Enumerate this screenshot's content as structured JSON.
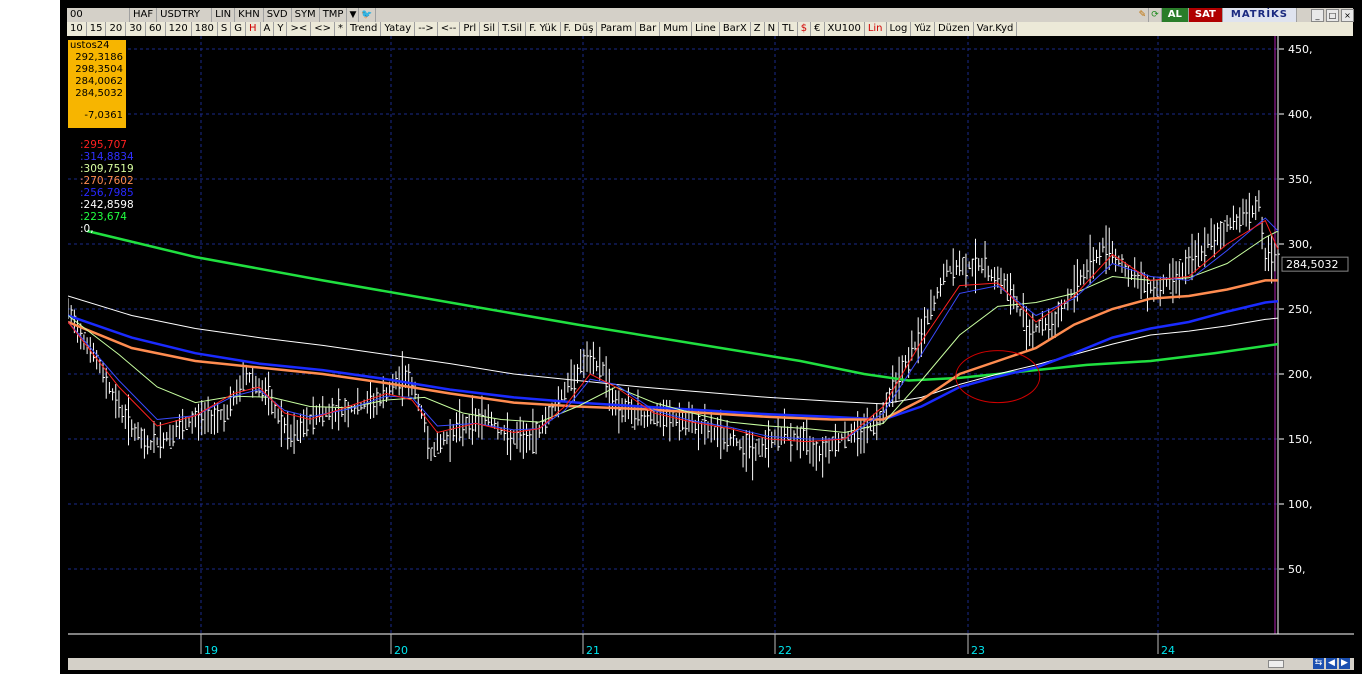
{
  "toolbar1": {
    "period_label": "00",
    "items": [
      "HAF",
      "USDTRY",
      "LIN",
      "KHN",
      "SVD",
      "SYM",
      "TMP"
    ],
    "buy": "AL",
    "sell": "SAT",
    "brand": "MATRİKS"
  },
  "toolbar2": {
    "items": [
      "10",
      "15",
      "20",
      "30",
      "60",
      "120",
      "180",
      "S",
      "G",
      "H",
      "A",
      "Y",
      ">< ",
      "<>",
      "*",
      "Trend",
      "Yatay",
      "-->",
      "<--",
      "Prl",
      "Sil",
      "T.Sil",
      "F. Yük",
      "F. Düş",
      "Param",
      "Bar",
      "Mum",
      "Line",
      "BarX",
      "Z",
      "N",
      "TL",
      "$",
      "€",
      "XU100",
      "Lin",
      "Log",
      "Yüz",
      "Düzen",
      "Var.Kyd"
    ],
    "active": [
      "H",
      "$",
      "Lin"
    ]
  },
  "ohlc": {
    "date": "ustos24",
    "open": "292,3186",
    "high": "298,3504",
    "low": "284,0062",
    "close": "284,5032",
    "change": "-7,0361"
  },
  "ma_legend": [
    {
      "label": ":295,707",
      "color": "#ff2020"
    },
    {
      "label": ":314,8834",
      "color": "#3030ff"
    },
    {
      "label": ":309,7519",
      "color": "#d8ffa0"
    },
    {
      "label": ":270,7602",
      "color": "#ff8c50"
    },
    {
      "label": ":256,7985",
      "color": "#2828ff"
    },
    {
      "label": ":242,8598",
      "color": "#ffffff"
    },
    {
      "label": ":223,674",
      "color": "#20ff40"
    },
    {
      "label": ":0,",
      "color": "#ffffff"
    }
  ],
  "last_price_label": "284,5032",
  "colors": {
    "background": "#000000",
    "grid": "#1a2a8a",
    "axis_text": "#ffffff",
    "date_text": "#00e5ee",
    "ma_slowest": "#20e040",
    "ma_orange": "#ff8c50",
    "ma_blue": "#1a2bff",
    "ma_white": "#ffffff",
    "annotation": "#d00000"
  },
  "chart_data": {
    "type": "line",
    "title": "",
    "y_ticks": [
      50,
      100,
      150,
      200,
      250,
      300,
      350,
      400,
      450
    ],
    "y_tick_labels": [
      "50,",
      "100,",
      "150,",
      "200,",
      "250,",
      "300,",
      "350,",
      "400,",
      "450,"
    ],
    "ylim": [
      0,
      460
    ],
    "x_ticks": [
      "19",
      "20",
      "21",
      "22",
      "23",
      "24"
    ],
    "x_tick_positions": [
      9,
      29,
      49,
      69,
      89,
      109
    ],
    "xlim": [
      0,
      125
    ],
    "series": [
      {
        "key": "price",
        "values": [
          [
            0,
            248
          ],
          [
            4,
            215
          ],
          [
            8,
            175
          ],
          [
            12,
            145
          ],
          [
            15,
            150
          ],
          [
            20,
            165
          ],
          [
            25,
            170
          ],
          [
            28,
            200
          ],
          [
            31,
            185
          ],
          [
            35,
            150
          ],
          [
            39,
            170
          ],
          [
            44,
            172
          ],
          [
            49,
            180
          ],
          [
            53,
            200
          ],
          [
            55,
            180
          ],
          [
            57,
            140
          ],
          [
            61,
            158
          ],
          [
            66,
            168
          ],
          [
            69,
            150
          ],
          [
            73,
            150
          ],
          [
            77,
            180
          ],
          [
            81,
            210
          ],
          [
            84,
            205
          ],
          [
            86,
            175
          ],
          [
            90,
            168
          ],
          [
            95,
            165
          ],
          [
            99,
            160
          ],
          [
            104,
            150
          ],
          [
            108,
            140
          ],
          [
            112,
            155
          ],
          [
            115,
            150
          ],
          [
            118,
            140
          ],
          [
            121,
            150
          ],
          [
            124,
            155
          ],
          [
            127,
            162
          ],
          [
            130,
            195
          ],
          [
            134,
            230
          ],
          [
            138,
            280
          ],
          [
            143,
            285
          ],
          [
            147,
            270
          ],
          [
            151,
            235
          ],
          [
            155,
            240
          ],
          [
            159,
            275
          ],
          [
            163,
            300
          ],
          [
            167,
            275
          ],
          [
            171,
            265
          ],
          [
            175,
            280
          ],
          [
            179,
            300
          ],
          [
            183,
            318
          ],
          [
            187,
            330
          ],
          [
            188,
            290
          ],
          [
            190,
            284
          ]
        ]
      },
      {
        "key": "ma_red",
        "values": [
          [
            0,
            240
          ],
          [
            8,
            190
          ],
          [
            14,
            160
          ],
          [
            20,
            168
          ],
          [
            26,
            185
          ],
          [
            30,
            190
          ],
          [
            34,
            170
          ],
          [
            38,
            165
          ],
          [
            44,
            175
          ],
          [
            50,
            185
          ],
          [
            54,
            180
          ],
          [
            58,
            155
          ],
          [
            64,
            162
          ],
          [
            70,
            155
          ],
          [
            74,
            158
          ],
          [
            78,
            175
          ],
          [
            82,
            200
          ],
          [
            86,
            190
          ],
          [
            92,
            170
          ],
          [
            98,
            163
          ],
          [
            104,
            158
          ],
          [
            110,
            150
          ],
          [
            116,
            148
          ],
          [
            122,
            150
          ],
          [
            128,
            175
          ],
          [
            134,
            225
          ],
          [
            140,
            268
          ],
          [
            146,
            270
          ],
          [
            152,
            240
          ],
          [
            158,
            260
          ],
          [
            164,
            292
          ],
          [
            170,
            272
          ],
          [
            176,
            275
          ],
          [
            182,
            300
          ],
          [
            188,
            318
          ],
          [
            190,
            296
          ]
        ]
      },
      {
        "key": "ma_blue_fast",
        "values": [
          [
            0,
            240
          ],
          [
            8,
            195
          ],
          [
            14,
            165
          ],
          [
            20,
            168
          ],
          [
            26,
            183
          ],
          [
            30,
            188
          ],
          [
            34,
            172
          ],
          [
            38,
            167
          ],
          [
            44,
            173
          ],
          [
            50,
            183
          ],
          [
            54,
            182
          ],
          [
            58,
            160
          ],
          [
            64,
            162
          ],
          [
            70,
            157
          ],
          [
            74,
            158
          ],
          [
            78,
            172
          ],
          [
            82,
            196
          ],
          [
            86,
            192
          ],
          [
            92,
            172
          ],
          [
            98,
            164
          ],
          [
            104,
            159
          ],
          [
            110,
            152
          ],
          [
            116,
            150
          ],
          [
            122,
            150
          ],
          [
            128,
            170
          ],
          [
            134,
            215
          ],
          [
            140,
            262
          ],
          [
            146,
            268
          ],
          [
            152,
            245
          ],
          [
            158,
            258
          ],
          [
            164,
            285
          ],
          [
            170,
            275
          ],
          [
            176,
            272
          ],
          [
            182,
            295
          ],
          [
            188,
            320
          ],
          [
            190,
            310
          ]
        ]
      },
      {
        "key": "ma_light_green",
        "values": [
          [
            0,
            245
          ],
          [
            8,
            215
          ],
          [
            14,
            190
          ],
          [
            20,
            178
          ],
          [
            26,
            183
          ],
          [
            32,
            182
          ],
          [
            38,
            175
          ],
          [
            44,
            174
          ],
          [
            50,
            180
          ],
          [
            56,
            182
          ],
          [
            62,
            170
          ],
          [
            68,
            165
          ],
          [
            74,
            163
          ],
          [
            80,
            175
          ],
          [
            86,
            190
          ],
          [
            92,
            178
          ],
          [
            98,
            170
          ],
          [
            104,
            163
          ],
          [
            110,
            160
          ],
          [
            116,
            158
          ],
          [
            122,
            155
          ],
          [
            128,
            162
          ],
          [
            134,
            195
          ],
          [
            140,
            230
          ],
          [
            146,
            252
          ],
          [
            152,
            255
          ],
          [
            158,
            262
          ],
          [
            164,
            275
          ],
          [
            170,
            272
          ],
          [
            176,
            274
          ],
          [
            182,
            285
          ],
          [
            188,
            305
          ],
          [
            190,
            310
          ]
        ]
      },
      {
        "key": "ma_orange",
        "values": [
          [
            0,
            240
          ],
          [
            10,
            220
          ],
          [
            20,
            210
          ],
          [
            30,
            205
          ],
          [
            40,
            200
          ],
          [
            50,
            193
          ],
          [
            60,
            185
          ],
          [
            70,
            178
          ],
          [
            80,
            175
          ],
          [
            90,
            173
          ],
          [
            100,
            170
          ],
          [
            110,
            167
          ],
          [
            120,
            165
          ],
          [
            128,
            165
          ],
          [
            134,
            180
          ],
          [
            140,
            200
          ],
          [
            146,
            210
          ],
          [
            152,
            220
          ],
          [
            158,
            238
          ],
          [
            164,
            250
          ],
          [
            170,
            258
          ],
          [
            176,
            260
          ],
          [
            182,
            265
          ],
          [
            188,
            272
          ],
          [
            190,
            272
          ]
        ]
      },
      {
        "key": "ma_blue",
        "values": [
          [
            0,
            245
          ],
          [
            10,
            228
          ],
          [
            20,
            216
          ],
          [
            30,
            208
          ],
          [
            40,
            203
          ],
          [
            50,
            196
          ],
          [
            60,
            188
          ],
          [
            70,
            182
          ],
          [
            80,
            178
          ],
          [
            90,
            175
          ],
          [
            100,
            172
          ],
          [
            110,
            169
          ],
          [
            120,
            167
          ],
          [
            128,
            165
          ],
          [
            134,
            175
          ],
          [
            140,
            190
          ],
          [
            146,
            198
          ],
          [
            152,
            205
          ],
          [
            158,
            216
          ],
          [
            164,
            228
          ],
          [
            170,
            235
          ],
          [
            176,
            240
          ],
          [
            182,
            248
          ],
          [
            188,
            255
          ],
          [
            190,
            256
          ]
        ]
      },
      {
        "key": "ma_white",
        "values": [
          [
            0,
            260
          ],
          [
            10,
            245
          ],
          [
            20,
            235
          ],
          [
            30,
            228
          ],
          [
            40,
            222
          ],
          [
            50,
            215
          ],
          [
            60,
            208
          ],
          [
            70,
            200
          ],
          [
            80,
            195
          ],
          [
            90,
            190
          ],
          [
            100,
            186
          ],
          [
            110,
            182
          ],
          [
            120,
            179
          ],
          [
            128,
            177
          ],
          [
            134,
            182
          ],
          [
            140,
            192
          ],
          [
            146,
            200
          ],
          [
            152,
            207
          ],
          [
            158,
            215
          ],
          [
            164,
            223
          ],
          [
            170,
            230
          ],
          [
            176,
            233
          ],
          [
            182,
            237
          ],
          [
            188,
            242
          ],
          [
            190,
            243
          ]
        ]
      },
      {
        "key": "ma_green",
        "values": [
          [
            3,
            310
          ],
          [
            20,
            290
          ],
          [
            40,
            272
          ],
          [
            60,
            255
          ],
          [
            80,
            238
          ],
          [
            100,
            222
          ],
          [
            115,
            210
          ],
          [
            125,
            200
          ],
          [
            132,
            195
          ],
          [
            140,
            197
          ],
          [
            150,
            202
          ],
          [
            160,
            207
          ],
          [
            170,
            210
          ],
          [
            180,
            216
          ],
          [
            190,
            223
          ]
        ]
      }
    ],
    "x_domain": [
      0,
      190
    ]
  }
}
